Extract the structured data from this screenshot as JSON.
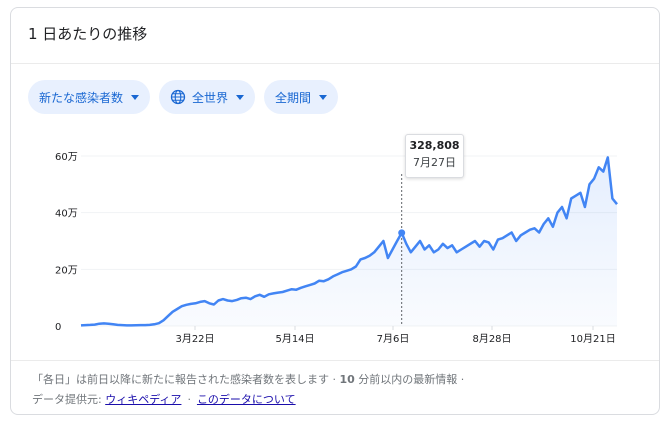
{
  "card": {
    "title": "1 日あたりの推移"
  },
  "filters": [
    {
      "label": "新たな感染者数"
    },
    {
      "label": "全世界",
      "icon": "globe-icon"
    },
    {
      "label": "全期間"
    }
  ],
  "tooltip": {
    "value": "328,808",
    "date": "7月27日"
  },
  "footer": {
    "line1_prefix": "「各日」は前日以降に新たに報告された感染者数を表します · ",
    "line1_bold": "10",
    "line1_suffix": " 分前以内の最新情報 ·",
    "source_label": "データ提供元: ",
    "source_link": "ウィキペディア",
    "about_link": "このデータについて"
  },
  "colors": {
    "line": "#4285f4",
    "chip_bg": "#e8f0fe",
    "chip_text": "#1967d2"
  },
  "chart_data": {
    "type": "area",
    "title": "1 日あたりの推移",
    "ylim": [
      0,
      600000
    ],
    "y_ticks": [
      {
        "value": 0,
        "label": "0"
      },
      {
        "value": 200000,
        "label": "20万"
      },
      {
        "value": 400000,
        "label": "40万"
      },
      {
        "value": 600000,
        "label": "60万"
      }
    ],
    "x_ticks": [
      "3月22日",
      "5月14日",
      "7月6日",
      "8月28日",
      "10月21日"
    ],
    "highlight": {
      "label": "7月27日",
      "value": 328808
    },
    "series": [
      {
        "values": [
          2000,
          3000,
          4000,
          5000,
          8000,
          9000,
          8000,
          6000,
          4000,
          3000,
          2000,
          2000,
          2500,
          3000,
          3000,
          4000,
          6000,
          10000,
          20000,
          35000,
          50000,
          60000,
          70000,
          75000,
          78000,
          80000,
          85000,
          88000,
          80000,
          76000,
          90000,
          95000,
          90000,
          88000,
          92000,
          98000,
          100000,
          95000,
          105000,
          110000,
          103000,
          112000,
          115000,
          118000,
          120000,
          125000,
          130000,
          128000,
          135000,
          140000,
          145000,
          150000,
          160000,
          158000,
          165000,
          175000,
          182000,
          190000,
          195000,
          200000,
          210000,
          235000,
          240000,
          248000,
          260000,
          280000,
          300000,
          240000,
          270000,
          300000,
          328808,
          290000,
          260000,
          280000,
          300000,
          270000,
          285000,
          260000,
          270000,
          290000,
          275000,
          285000,
          260000,
          270000,
          280000,
          290000,
          300000,
          280000,
          300000,
          295000,
          270000,
          305000,
          310000,
          320000,
          330000,
          300000,
          320000,
          330000,
          340000,
          345000,
          330000,
          360000,
          380000,
          350000,
          400000,
          420000,
          380000,
          450000,
          460000,
          470000,
          420000,
          500000,
          520000,
          560000,
          545000,
          595000,
          450000,
          430000
        ]
      }
    ]
  }
}
